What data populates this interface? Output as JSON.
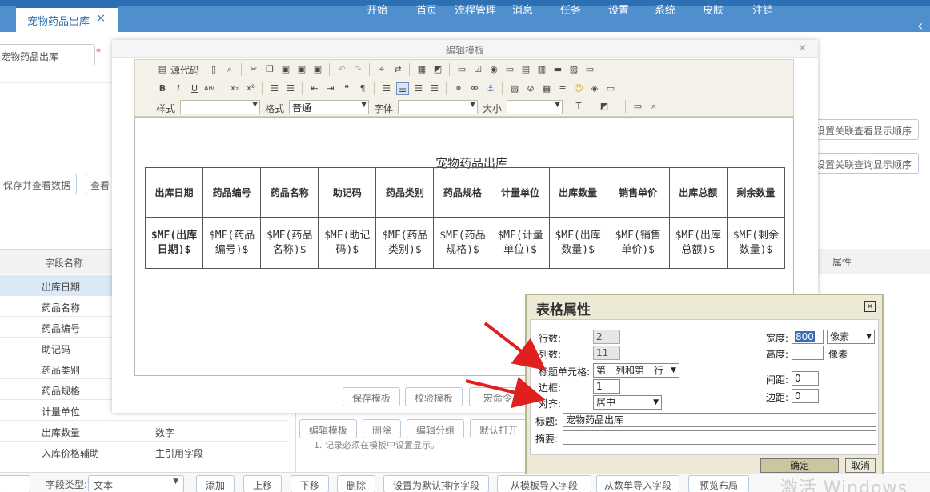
{
  "header": {
    "tab_label": "宠物药品出库",
    "tab_close": "×",
    "menu": [
      "开始",
      "首页",
      "流程管理",
      "消息",
      "任务",
      "设置",
      "系统",
      "皮肤",
      "注销"
    ],
    "collapse_glyph": "‹"
  },
  "background": {
    "name_input_value": "宠物药品出库",
    "required_mark": "*",
    "save_view_btn": "保存并查看数据",
    "view_btn": "查看",
    "assoc_view_order_btn": "设置关联查看显示顺序",
    "assoc_query_order_btn": "设置关联查询显示顺序",
    "attr_header": "属性",
    "field_grid_header": "字段名称",
    "fields": [
      "出库日期",
      "药品名称",
      "药品编号",
      "助记码",
      "药品类别",
      "药品规格",
      "计量单位",
      "出库数量",
      "入库价格辅助"
    ],
    "field_types": [
      "",
      "",
      "",
      "",
      "",
      "",
      "",
      "数字",
      "主引用字段"
    ],
    "side_note": "1. 记录必须在模板中设置显示。"
  },
  "bottombar": {
    "field_type_label": "字段类型:",
    "field_type_value": "文本",
    "buttons": [
      "添加",
      "上移",
      "下移",
      "删除",
      "设置为默认排序字段",
      "从模板导入字段",
      "从数单导入字段",
      "预览布局"
    ],
    "watermark": "激活 Windows"
  },
  "edit_window": {
    "title": "编辑模板",
    "close": "×",
    "toolbar": {
      "source_label": "源代码",
      "style_label": "样式",
      "format_label": "格式",
      "format_value": "普通",
      "font_label": "字体",
      "size_label": "大小"
    },
    "doc_title": "宠物药品出库",
    "table_headers": [
      "出库日期",
      "药品编号",
      "药品名称",
      "助记码",
      "药品类别",
      "药品规格",
      "计量单位",
      "出库数量",
      "销售单价",
      "出库总额",
      "剩余数量"
    ],
    "table_cells": [
      "$MF(出库日期)$",
      "$MF(药品编号)$",
      "$MF(药品名称)$",
      "$MF(助记码)$",
      "$MF(药品类别)$",
      "$MF(药品规格)$",
      "$MF(计量单位)$",
      "$MF(出库数量)$",
      "$MF(销售单价)$",
      "$MF(出库总额)$",
      "$MF(剩余数量)$"
    ],
    "buttons": [
      "保存模板",
      "校验模板",
      "宏命令"
    ],
    "buttons_row2": [
      "编辑模板",
      "删除",
      "编辑分组",
      "默认打开"
    ]
  },
  "dialog": {
    "title": "表格属性",
    "close": "×",
    "rows_label": "行数:",
    "rows_value": "2",
    "cols_label": "列数:",
    "cols_value": "11",
    "header_cell_label": "标题单元格:",
    "header_cell_value": "第一列和第一行",
    "border_label": "边框:",
    "border_value": "1",
    "align_label": "对齐:",
    "align_value": "居中",
    "width_label": "宽度:",
    "width_value": "800",
    "width_unit": "像素",
    "height_label": "高度:",
    "height_value": "",
    "height_unit": "像素",
    "spacing_label": "间距:",
    "spacing_value": "0",
    "padding_label": "边距:",
    "padding_value": "0",
    "caption_label": "标题:",
    "caption_value": "宠物药品出库",
    "summary_label": "摘要:",
    "summary_value": "",
    "ok_label": "确定",
    "cancel_label": "取消"
  },
  "colors": {
    "header_blue": "#2c6fb2",
    "tab_strip": "#4f8fce",
    "dialog_bg": "#ecead6",
    "arrow_red": "#e02020"
  }
}
